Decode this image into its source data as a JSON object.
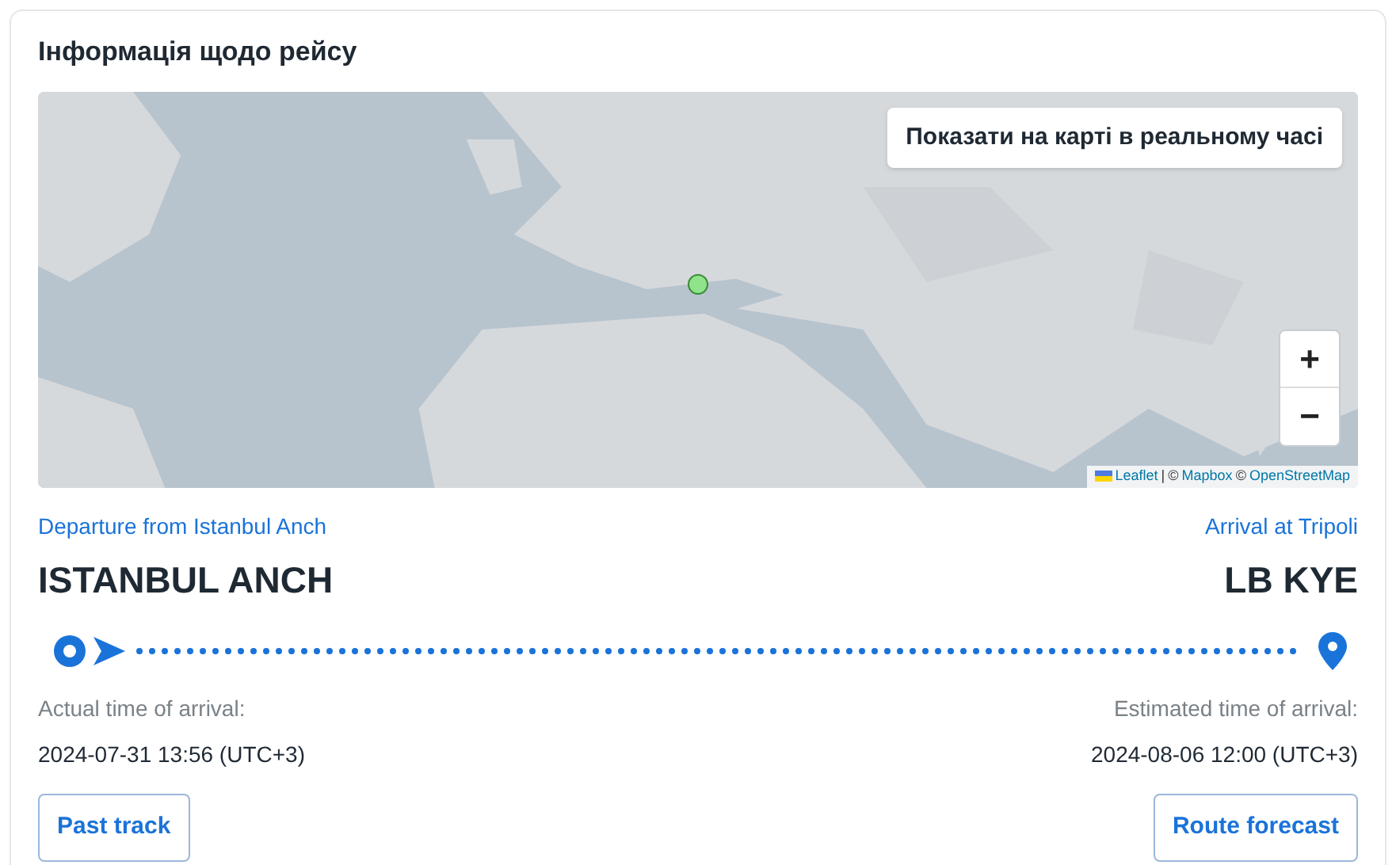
{
  "title": "Інформація щодо рейсу",
  "map": {
    "realtime_button": "Показати на карті в реальному часі",
    "zoom_in": "+",
    "zoom_out": "−",
    "attribution": {
      "leaflet": "Leaflet",
      "separator": "|",
      "mapbox_prefix": "©",
      "mapbox": "Mapbox",
      "osm_prefix": "©",
      "osm": "OpenStreetMap"
    }
  },
  "departure": {
    "label": "Departure from Istanbul Anch",
    "port": "ISTANBUL ANCH"
  },
  "arrival": {
    "label": "Arrival at Tripoli",
    "port": "LB KYE"
  },
  "actual": {
    "label": "Actual time of arrival:",
    "value": "2024-07-31 13:56 (UTC+3)"
  },
  "estimated": {
    "label": "Estimated time of arrival:",
    "value": "2024-08-06 12:00 (UTC+3)"
  },
  "buttons": [
    {
      "label": "Past track"
    },
    {
      "label": "Route forecast"
    }
  ]
}
